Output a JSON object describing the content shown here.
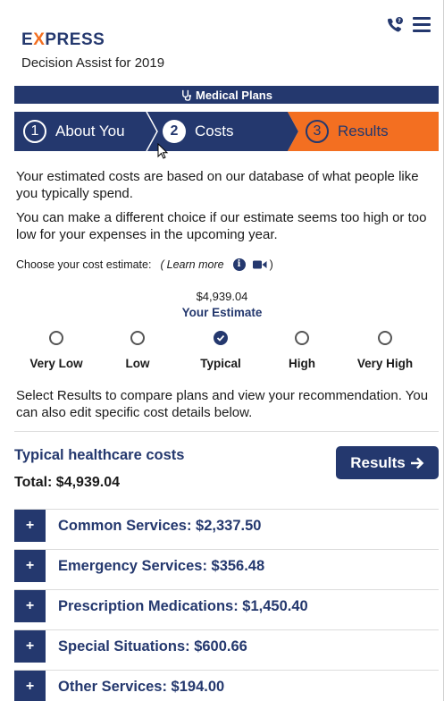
{
  "header": {
    "logo_prefix": "E",
    "logo_x": "X",
    "logo_suffix": "PRESS",
    "subtitle": "Decision Assist for 2019"
  },
  "icons": {
    "phone": "phone-chat-icon",
    "menu": "hamburger-menu-icon",
    "stethoscope": "stethoscope-icon",
    "info": "info-icon",
    "video": "video-icon",
    "check": "check-icon",
    "arrow": "arrow-right-icon",
    "plus": "plus-icon"
  },
  "colors": {
    "navy": "#24386e",
    "orange": "#f36f21"
  },
  "plan_bar": {
    "label": "Medical Plans"
  },
  "steps": [
    {
      "num": "1",
      "label": "About You",
      "state": "completed"
    },
    {
      "num": "2",
      "label": "Costs",
      "state": "active"
    },
    {
      "num": "3",
      "label": "Results",
      "state": "upcoming"
    }
  ],
  "intro": {
    "p1": "Your estimated costs are based on our database of what people like you typically spend.",
    "p2": "You can make a different choice if our estimate seems too high or too low for your expenses in the upcoming year."
  },
  "choose": {
    "label": "Choose your cost estimate:",
    "open_paren": "(",
    "learn_more": "Learn more",
    "close_paren": ")"
  },
  "estimate": {
    "amount": "$4,939.04",
    "label": "Your Estimate"
  },
  "options": [
    {
      "label": "Very Low",
      "selected": false
    },
    {
      "label": "Low",
      "selected": false
    },
    {
      "label": "Typical",
      "selected": true
    },
    {
      "label": "High",
      "selected": false
    },
    {
      "label": "Very High",
      "selected": false
    }
  ],
  "instructions": "Select Results to compare plans and view your recommendation. You can also edit specific cost details below.",
  "costs": {
    "title": "Typical healthcare costs",
    "total": "Total: $4,939.04",
    "results_button": "Results",
    "plus_symbol": "+",
    "sections": [
      "Common Services: $2,337.50",
      "Emergency Services: $356.48",
      "Prescription Medications: $1,450.40",
      "Special Situations: $600.66",
      "Other Services: $194.00"
    ]
  }
}
